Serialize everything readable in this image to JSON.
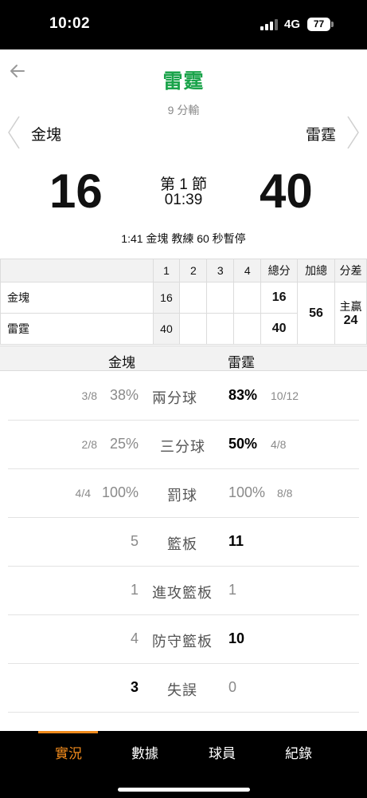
{
  "status_bar": {
    "time": "10:02",
    "network": "4G",
    "battery": "77"
  },
  "header": {
    "title": "雷霆",
    "subtitle": "9 分輸"
  },
  "teams": {
    "left": "金塊",
    "right": "雷霆"
  },
  "scoreboard": {
    "left_score": "16",
    "right_score": "40",
    "period": "第 1 節",
    "clock": "01:39",
    "last_event": "1:41 金塊  教練 60 秒暫停"
  },
  "box_score": {
    "headers": [
      "",
      "1",
      "2",
      "3",
      "4",
      "總分",
      "加總",
      "分差"
    ],
    "rows": [
      {
        "team": "金塊",
        "q1": "16",
        "q2": "",
        "q3": "",
        "q4": "",
        "total": "16"
      },
      {
        "team": "雷霆",
        "q1": "40",
        "q2": "",
        "q3": "",
        "q4": "",
        "total": "40"
      }
    ],
    "sum": "56",
    "diff_label": "主贏",
    "diff_value": "24"
  },
  "stats": {
    "left_team": "金塊",
    "right_team": "雷霆",
    "rows": [
      {
        "left_frac": "3/8",
        "left_val": "38%",
        "label": "兩分球",
        "right_val": "83%",
        "right_frac": "10/12"
      },
      {
        "left_frac": "2/8",
        "left_val": "25%",
        "label": "三分球",
        "right_val": "50%",
        "right_frac": "4/8"
      },
      {
        "left_frac": "4/4",
        "left_val": "100%",
        "label": "罰球",
        "right_val": "100%",
        "right_frac": "8/8"
      },
      {
        "left_val": "5",
        "label": "籃板",
        "right_val": "11"
      },
      {
        "left_val": "1",
        "label": "進攻籃板",
        "right_val": "1"
      },
      {
        "left_val": "4",
        "label": "防守籃板",
        "right_val": "10"
      },
      {
        "left_val": "3",
        "label": "失誤",
        "right_val": "0"
      }
    ]
  },
  "tabs": [
    "實況",
    "數據",
    "球員",
    "紀錄"
  ],
  "colors": {
    "title_green": "#1aa34a",
    "active_tab_orange": "#f08a1c"
  }
}
